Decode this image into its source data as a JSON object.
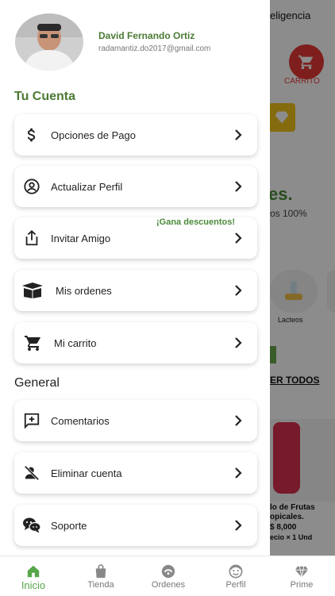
{
  "background": {
    "title_fragment": "eligencia",
    "cart_label": "CARRITO",
    "headline_fragment": "es.",
    "subtext_fragment": "os 100%",
    "category_label": "Lacteos",
    "see_all": "ER TODOS",
    "product_name": "lo de Frutas\nopicales.",
    "product_price": "$ 8,000",
    "product_unit": "ecio × 1 Und"
  },
  "profile": {
    "name": "David Fernando Ortiz",
    "email": "radamantiz.do2017@gmail.com"
  },
  "account_section": {
    "title": "Tu Cuenta",
    "promo_text": "¡Gana descuentos!",
    "items": [
      {
        "label": "Opciones de Pago",
        "icon": "dollar-icon"
      },
      {
        "label": "Actualizar Perfil",
        "icon": "user-circle-icon"
      },
      {
        "label": "Invitar Amigo",
        "icon": "share-icon"
      },
      {
        "label": "Mis ordenes",
        "icon": "box-icon"
      },
      {
        "label": "Mi carrito",
        "icon": "cart-icon"
      }
    ]
  },
  "general_section": {
    "title": "General",
    "items": [
      {
        "label": "Comentarios",
        "icon": "comment-add-icon"
      },
      {
        "label": "Eliminar cuenta",
        "icon": "user-remove-icon"
      },
      {
        "label": "Soporte",
        "icon": "chat-icon"
      }
    ]
  },
  "bottom_nav": {
    "items": [
      {
        "label": "Inicio",
        "icon": "home-icon",
        "active": true
      },
      {
        "label": "Tienda",
        "icon": "bag-icon",
        "active": false
      },
      {
        "label": "Ordenes",
        "icon": "orders-icon",
        "active": false
      },
      {
        "label": "Perfil",
        "icon": "face-icon",
        "active": false
      },
      {
        "label": "Prime",
        "icon": "diamond-icon",
        "active": false
      }
    ]
  },
  "colors": {
    "brand_green": "#4a7a34",
    "active_nav_green": "#57a64a",
    "cart_red": "#e53935"
  }
}
